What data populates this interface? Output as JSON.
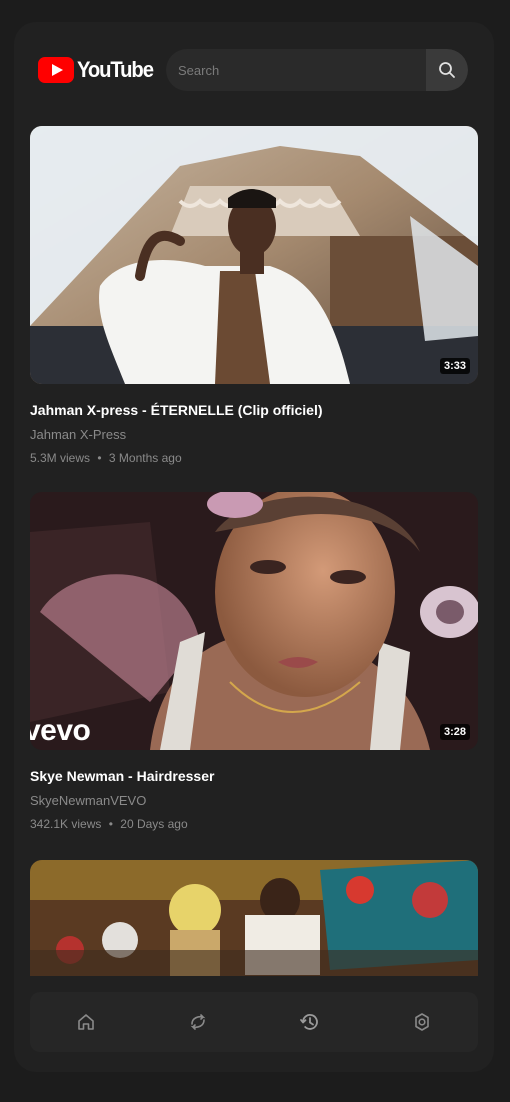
{
  "app": {
    "logo_text": "YouTube"
  },
  "search": {
    "placeholder": "Search"
  },
  "videos": [
    {
      "title": "Jahman X-press - ÉTERNELLE (Clip officiel)",
      "channel": "Jahman X-Press",
      "views": "5.3M views",
      "age": "3 Months ago",
      "duration": "3:33"
    },
    {
      "title": "Skye Newman - Hairdresser",
      "channel": "SkyeNewmanVEVO",
      "views": "342.1K views",
      "age": "20 Days ago",
      "duration": "3:28",
      "watermark": "vevo"
    },
    {
      "title": "",
      "channel": "",
      "views": "",
      "age": "",
      "duration": ""
    }
  ],
  "meta_separator": "•",
  "nav": {
    "items": [
      {
        "icon": "home-icon"
      },
      {
        "icon": "explore-icon"
      },
      {
        "icon": "history-icon"
      },
      {
        "icon": "settings-icon"
      }
    ]
  },
  "colors": {
    "background": "#1c1c1c",
    "surface": "#212121",
    "brand_red": "#ff0000",
    "secondary_text": "#8a8a8a"
  }
}
